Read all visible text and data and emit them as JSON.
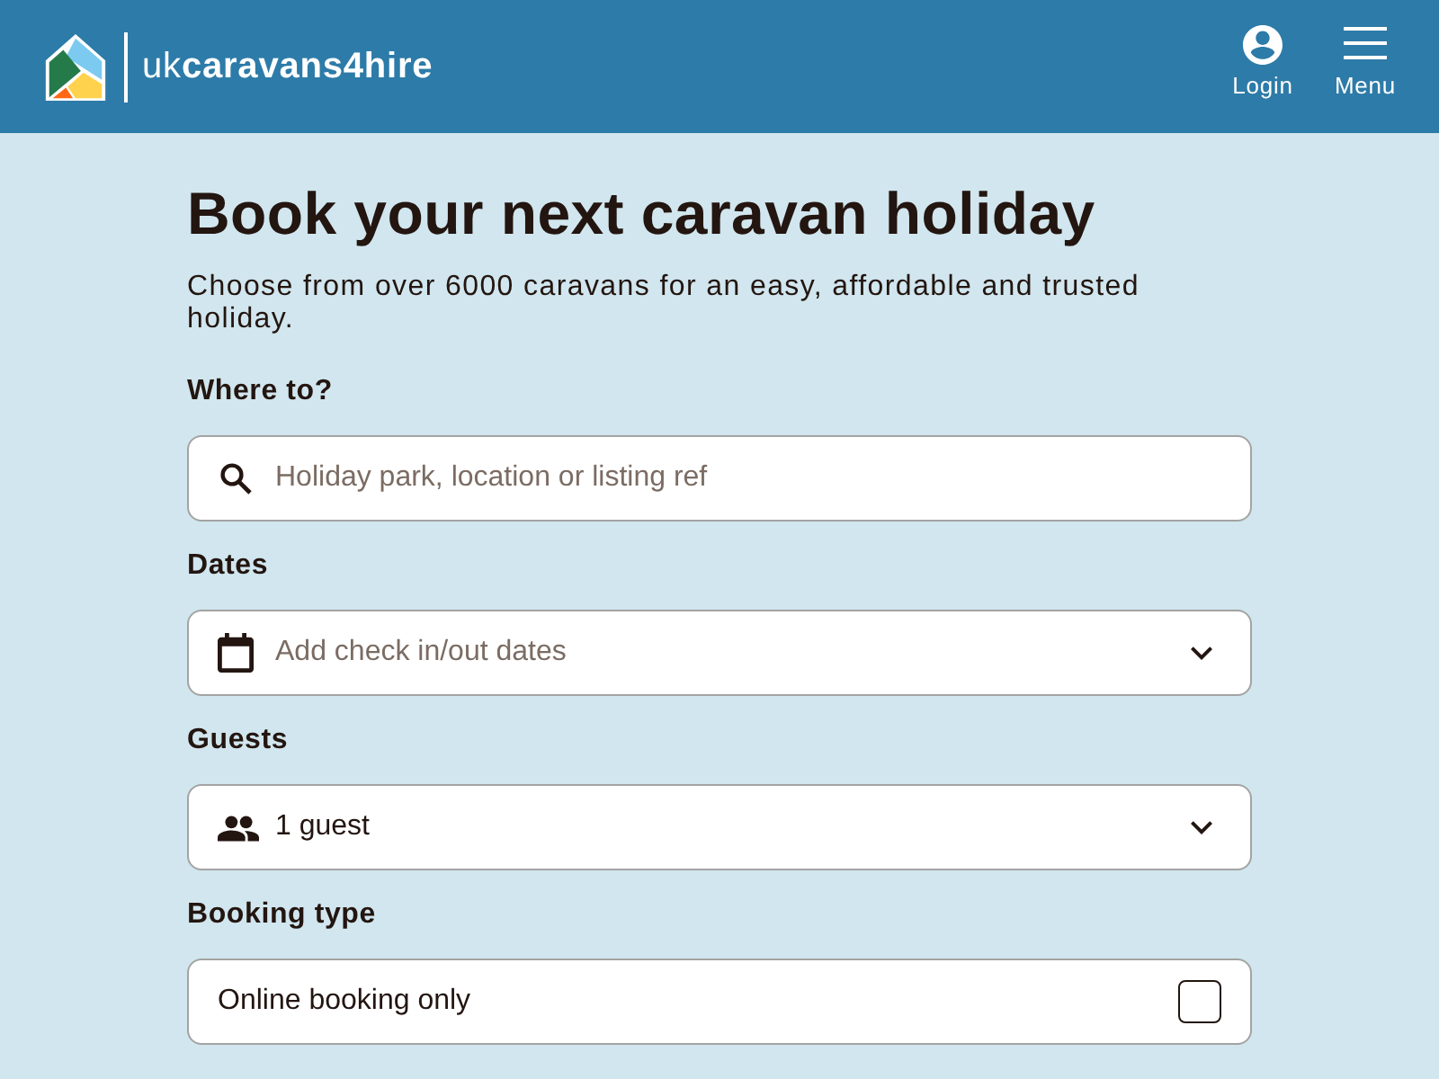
{
  "header": {
    "logo": "uk**caravans4hire**",
    "actions": [
      {
        "kind": "login",
        "label": "Login"
      },
      {
        "kind": "menu",
        "label": "Menu"
      }
    ]
  },
  "hero": {
    "title": "Book your next caravan holiday",
    "subtitle": "Choose from over 6000 caravans for an easy, affordable and trusted holiday."
  },
  "form": {
    "fields": [
      {
        "kind": "search",
        "label": "Where to?",
        "placeholder": "Holiday park, location or listing ref"
      },
      {
        "kind": "dates",
        "label": "Dates",
        "placeholder": "Add check in/out dates"
      },
      {
        "kind": "guests",
        "label": "Guests",
        "value": "1 guest"
      },
      {
        "kind": "checkbox",
        "label": "Booking type",
        "option": "Online booking only",
        "checked": false
      }
    ]
  }
}
